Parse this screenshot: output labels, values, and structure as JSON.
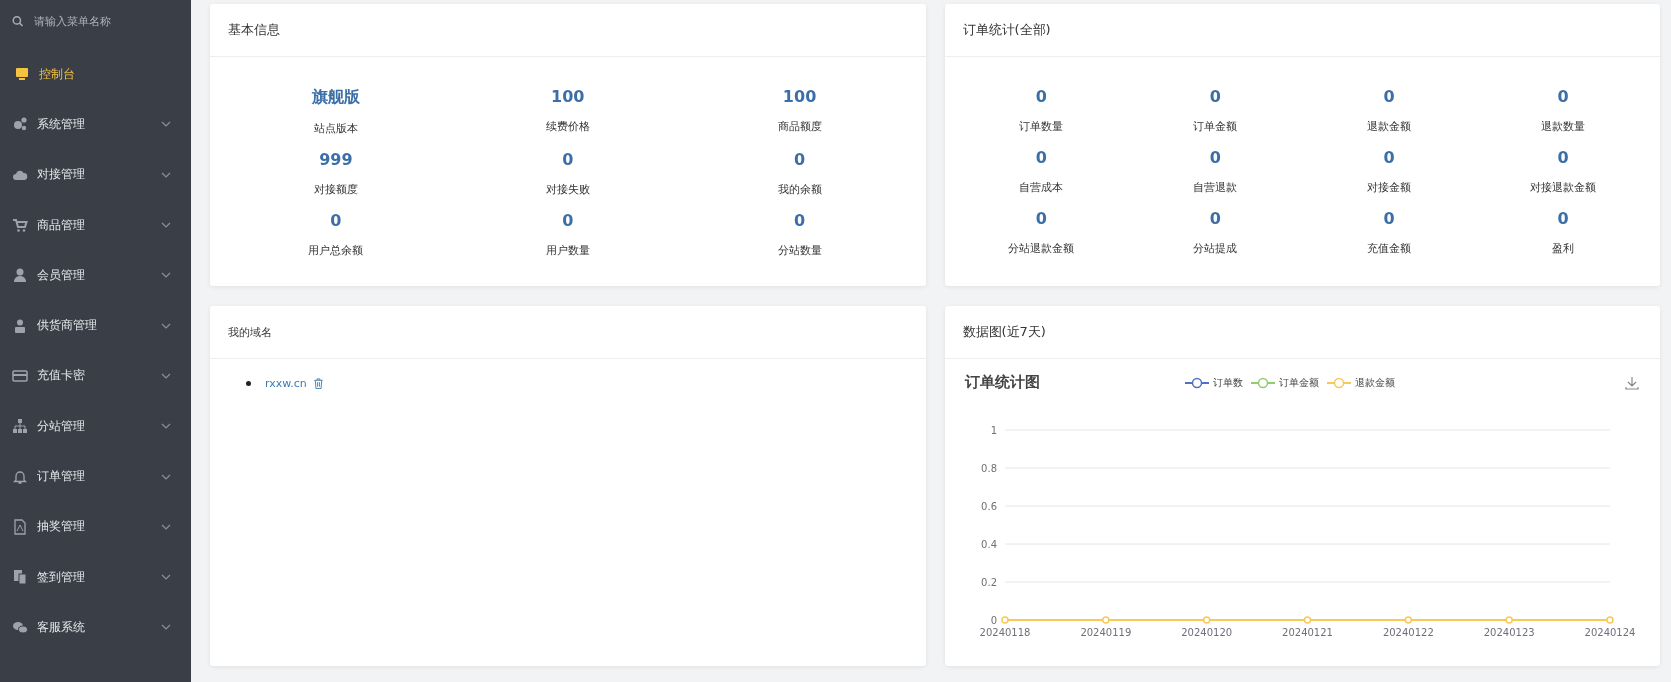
{
  "sidebar": {
    "search": {
      "placeholder": "请输入菜单名称"
    },
    "items": [
      {
        "label": "控制台",
        "kind": "link",
        "selected": true
      },
      {
        "label": "系统管理",
        "kind": "menu",
        "selected": false,
        "expanded": false
      },
      {
        "label": "对接管理",
        "kind": "menu",
        "selected": false,
        "expanded": false
      },
      {
        "label": "商品管理",
        "kind": "menu",
        "selected": false,
        "expanded": false
      },
      {
        "label": "会员管理",
        "kind": "menu",
        "selected": false,
        "expanded": false
      },
      {
        "label": "供货商管理",
        "kind": "menu",
        "selected": false,
        "expanded": false
      },
      {
        "label": "充值卡密",
        "kind": "menu",
        "selected": false,
        "expanded": false
      },
      {
        "label": "分站管理",
        "kind": "menu",
        "selected": false,
        "expanded": false
      },
      {
        "label": "订单管理",
        "kind": "menu",
        "selected": false,
        "expanded": false
      },
      {
        "label": "抽奖管理",
        "kind": "menu",
        "selected": false,
        "expanded": false
      },
      {
        "label": "签到管理",
        "kind": "menu",
        "selected": false,
        "expanded": false
      },
      {
        "label": "客服系统",
        "kind": "menu",
        "selected": false,
        "expanded": false
      }
    ]
  },
  "basic_info": {
    "title": "基本信息",
    "stats": [
      {
        "value": "旗舰版",
        "label": "站点版本"
      },
      {
        "value": "100",
        "label": "续费价格"
      },
      {
        "value": "100",
        "label": "商品额度"
      },
      {
        "value": "999",
        "label": "对接额度"
      },
      {
        "value": "0",
        "label": "对接失败"
      },
      {
        "value": "0",
        "label": "我的余额"
      },
      {
        "value": "0",
        "label": "用户总余额"
      },
      {
        "value": "0",
        "label": "用户数量"
      },
      {
        "value": "0",
        "label": "分站数量"
      }
    ]
  },
  "order_stats": {
    "title": "订单统计(全部)",
    "stats": [
      {
        "value": "0",
        "label": "订单数量"
      },
      {
        "value": "0",
        "label": "订单金额"
      },
      {
        "value": "0",
        "label": "退款金额"
      },
      {
        "value": "0",
        "label": "退款数量"
      },
      {
        "value": "0",
        "label": "自营成本"
      },
      {
        "value": "0",
        "label": "自营退款"
      },
      {
        "value": "0",
        "label": "对接金额"
      },
      {
        "value": "0",
        "label": "对接退款金额"
      },
      {
        "value": "0",
        "label": "分站退款金额"
      },
      {
        "value": "0",
        "label": "分站提成"
      },
      {
        "value": "0",
        "label": "充值金额"
      },
      {
        "value": "0",
        "label": "盈利"
      }
    ]
  },
  "domains": {
    "title": "我的域名",
    "items": [
      "rxxw.cn"
    ]
  },
  "data_chart": {
    "title": "数据图(近7天)",
    "chart_data": {
      "type": "line",
      "title": "订单统计图",
      "categories": [
        "20240118",
        "20240119",
        "20240120",
        "20240121",
        "20240122",
        "20240123",
        "20240124"
      ],
      "series": [
        {
          "name": "订单数",
          "color": "#5470c6",
          "marker": "circle",
          "values": [
            null,
            null,
            null,
            null,
            null,
            null,
            null
          ]
        },
        {
          "name": "订单金额",
          "color": "#91cc75",
          "marker": "circle",
          "values": [
            null,
            null,
            null,
            null,
            null,
            null,
            null
          ]
        },
        {
          "name": "退款金额",
          "color": "#fac858",
          "marker": "circle",
          "values": [
            0,
            0,
            0,
            0,
            0,
            0,
            0
          ]
        }
      ],
      "ylim": [
        0,
        1
      ],
      "yticks": [
        0,
        0.2,
        0.4,
        0.6,
        0.8,
        1
      ],
      "grid": true,
      "legend": "top"
    }
  }
}
